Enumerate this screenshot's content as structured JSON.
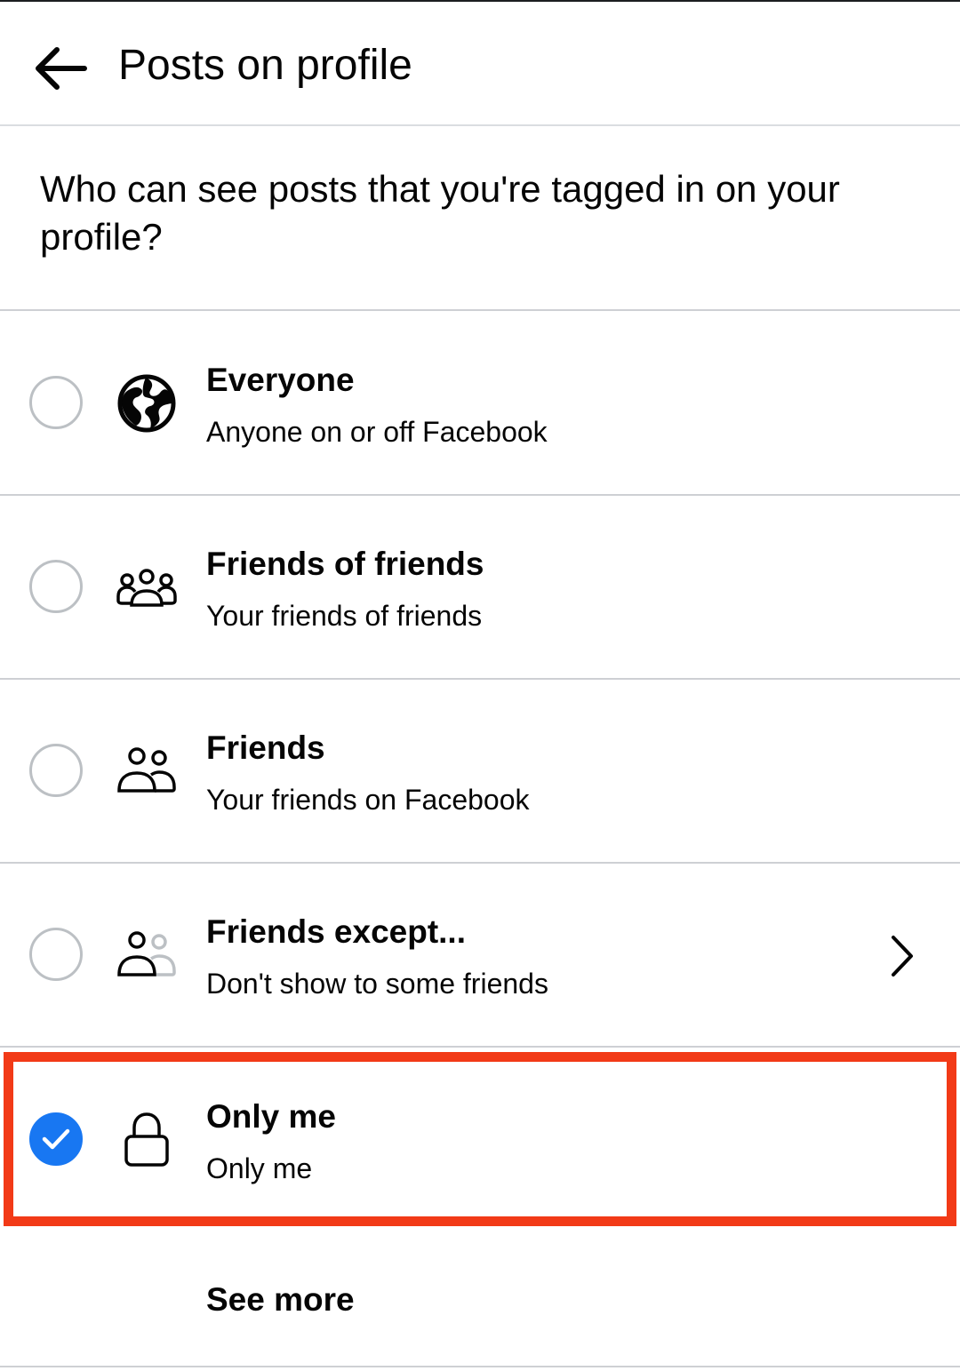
{
  "header": {
    "title": "Posts on profile",
    "back_icon": "arrow-left-icon"
  },
  "question": "Who can see posts that you're tagged in on your profile?",
  "options": [
    {
      "title": "Everyone",
      "subtitle": "Anyone on or off Facebook",
      "icon": "globe-icon",
      "selected": false
    },
    {
      "title": "Friends of friends",
      "subtitle": "Your friends of friends",
      "icon": "friends-of-friends-icon",
      "selected": false
    },
    {
      "title": "Friends",
      "subtitle": "Your friends on Facebook",
      "icon": "friends-icon",
      "selected": false
    },
    {
      "title": "Friends except...",
      "subtitle": "Don't show to some friends",
      "icon": "friends-except-icon",
      "selected": false,
      "has_chevron": true
    },
    {
      "title": "Only me",
      "subtitle": "Only me",
      "icon": "lock-icon",
      "selected": true
    }
  ],
  "see_more": "See more",
  "colors": {
    "accent": "#1877f2",
    "highlight": "#f23a17",
    "divider": "#ced0d4",
    "text": "#050505"
  }
}
